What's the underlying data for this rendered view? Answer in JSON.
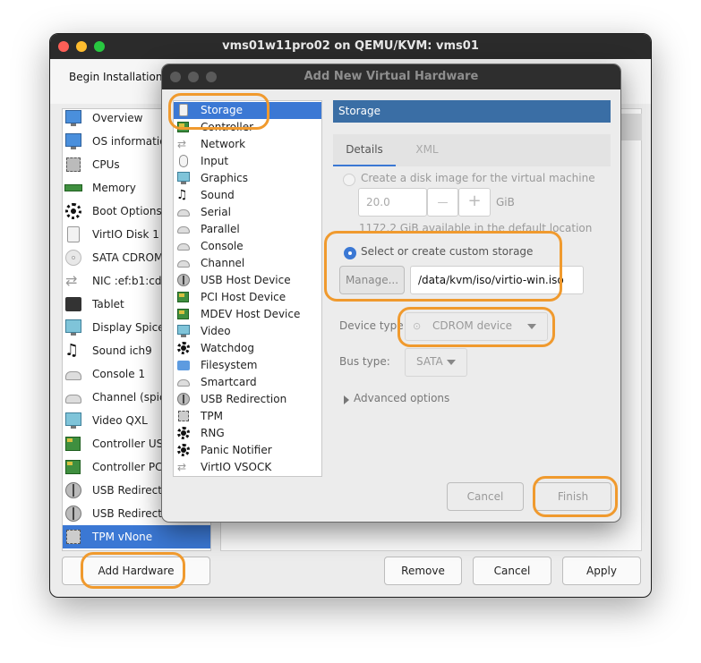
{
  "main_window": {
    "title": "vms01w11pro02 on QEMU/KVM: vms01",
    "begin_installation": "Begin Installation",
    "hardware_items": [
      {
        "label": "Overview",
        "icon": "monitor-icon"
      },
      {
        "label": "OS information",
        "icon": "monitor-icon"
      },
      {
        "label": "CPUs",
        "icon": "cpu-chip-icon"
      },
      {
        "label": "Memory",
        "icon": "memory-module-icon"
      },
      {
        "label": "Boot Options",
        "icon": "gear-icon"
      },
      {
        "label": "VirtIO Disk 1",
        "icon": "disk-icon"
      },
      {
        "label": "SATA CDROM",
        "icon": "cdrom-icon"
      },
      {
        "label": "NIC :ef:b1:cd",
        "icon": "network-arrows-icon"
      },
      {
        "label": "Tablet",
        "icon": "tablet-icon"
      },
      {
        "label": "Display Spice",
        "icon": "display-icon"
      },
      {
        "label": "Sound ich9",
        "icon": "sound-icon"
      },
      {
        "label": "Console 1",
        "icon": "serial-port-icon"
      },
      {
        "label": "Channel (spice)",
        "icon": "serial-port-icon"
      },
      {
        "label": "Video QXL",
        "icon": "display-icon"
      },
      {
        "label": "Controller USB",
        "icon": "controller-card-icon"
      },
      {
        "label": "Controller PCIe",
        "icon": "controller-card-icon"
      },
      {
        "label": "USB Redirector",
        "icon": "usb-icon"
      },
      {
        "label": "USB Redirector",
        "icon": "usb-icon"
      },
      {
        "label": "TPM vNone",
        "icon": "tpm-chip-icon"
      }
    ],
    "add_hardware": "Add Hardware",
    "remove": "Remove",
    "cancel": "Cancel",
    "apply": "Apply"
  },
  "dialog": {
    "title": "Add New Virtual Hardware",
    "device_types": [
      {
        "label": "Storage",
        "icon": "disk-icon"
      },
      {
        "label": "Controller",
        "icon": "controller-card-icon"
      },
      {
        "label": "Network",
        "icon": "network-arrows-icon"
      },
      {
        "label": "Input",
        "icon": "mouse-icon"
      },
      {
        "label": "Graphics",
        "icon": "display-icon"
      },
      {
        "label": "Sound",
        "icon": "sound-icon"
      },
      {
        "label": "Serial",
        "icon": "serial-port-icon"
      },
      {
        "label": "Parallel",
        "icon": "serial-port-icon"
      },
      {
        "label": "Console",
        "icon": "serial-port-icon"
      },
      {
        "label": "Channel",
        "icon": "serial-port-icon"
      },
      {
        "label": "USB Host Device",
        "icon": "usb-icon"
      },
      {
        "label": "PCI Host Device",
        "icon": "controller-card-icon"
      },
      {
        "label": "MDEV Host Device",
        "icon": "controller-card-icon"
      },
      {
        "label": "Video",
        "icon": "display-icon"
      },
      {
        "label": "Watchdog",
        "icon": "gear-icon"
      },
      {
        "label": "Filesystem",
        "icon": "folder-icon"
      },
      {
        "label": "Smartcard",
        "icon": "serial-port-icon"
      },
      {
        "label": "USB Redirection",
        "icon": "usb-icon"
      },
      {
        "label": "TPM",
        "icon": "tpm-chip-icon"
      },
      {
        "label": "RNG",
        "icon": "gear-icon"
      },
      {
        "label": "Panic Notifier",
        "icon": "gear-icon"
      },
      {
        "label": "VirtIO VSOCK",
        "icon": "network-arrows-icon"
      }
    ],
    "header": "Storage",
    "tabs": {
      "details": "Details",
      "xml": "XML"
    },
    "create_disk_label": "Create a disk image for the virtual machine",
    "disk_size": "20.0",
    "minus": "—",
    "plus": "+",
    "size_unit": "GiB",
    "available_text": "1172.2 GiB available in the default location",
    "custom_storage_label": "Select or create custom storage",
    "manage_button": "Manage...",
    "storage_path": "/data/kvm/iso/virtio-win.iso",
    "device_type_label": "Device type:",
    "device_type_value": "CDROM device",
    "bus_type_label": "Bus type:",
    "bus_type_value": "SATA",
    "advanced_options": "Advanced options",
    "cancel": "Cancel",
    "finish": "Finish"
  },
  "colors": {
    "selection": "#3b78d4",
    "header_blue": "#3a6ea5",
    "highlight_orange": "#f09a2e",
    "titlebar_dark": "#2b2b2b"
  }
}
